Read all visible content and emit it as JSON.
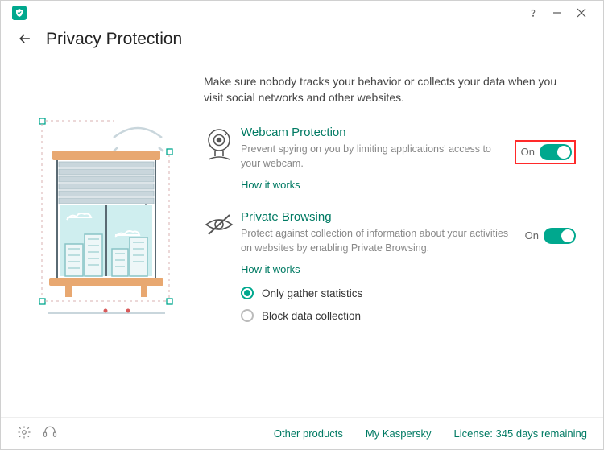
{
  "header": {
    "title": "Privacy Protection"
  },
  "intro": "Make sure nobody tracks your behavior or collects your data when you visit social networks and other websites.",
  "sections": {
    "webcam": {
      "title": "Webcam Protection",
      "desc": "Prevent spying on you by limiting applications' access to your webcam.",
      "link": "How it works",
      "toggle_state": "On"
    },
    "private": {
      "title": "Private Browsing",
      "desc": "Protect against collection of information about your activities on websites by enabling Private Browsing.",
      "link": "How it works",
      "toggle_state": "On",
      "radios": {
        "gather": "Only gather statistics",
        "block": "Block data collection"
      }
    }
  },
  "footer": {
    "other_products": "Other products",
    "my_kaspersky": "My Kaspersky",
    "license": "License: 345 days remaining"
  }
}
